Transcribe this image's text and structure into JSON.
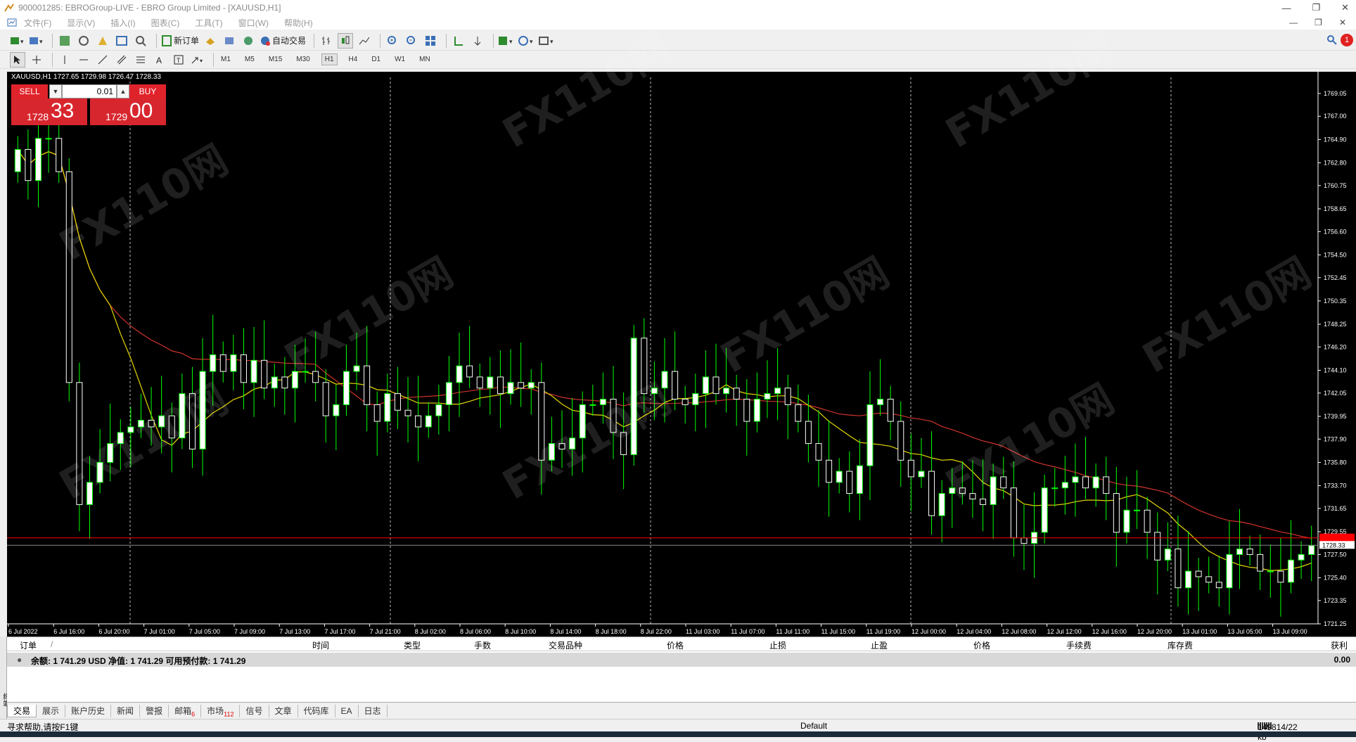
{
  "window": {
    "title": "900001285: EBROGroup-LIVE - EBRO Group Limited - [XAUUSD,H1]",
    "controls": [
      "—",
      "❐",
      "✕"
    ],
    "mdi_controls": [
      "—",
      "❐",
      "✕"
    ]
  },
  "menu": [
    "文件(F)",
    "显示(V)",
    "插入(I)",
    "图表(C)",
    "工具(T)",
    "窗口(W)",
    "帮助(H)"
  ],
  "toolbar": {
    "new_order": "新订单",
    "auto_trading": "自动交易",
    "timeframes": [
      "M1",
      "M5",
      "M15",
      "M30",
      "H1",
      "H4",
      "D1",
      "W1",
      "MN"
    ],
    "active_timeframe": "H1",
    "notification_count": "1"
  },
  "chart": {
    "header": "XAUUSD,H1  1727.65 1729.98 1726.47 1728.33",
    "trade_panel": {
      "sell_label": "SELL",
      "buy_label": "BUY",
      "lot": "0.01",
      "sell_small": "1728",
      "sell_big": "33",
      "buy_small": "1729",
      "buy_big": "00"
    },
    "bid_label": "1728.33",
    "ask_label": "1729.00",
    "watermark": "FX110网",
    "colors": {
      "background": "#000000",
      "bull_body": "#ffffff",
      "wick": "#00ff00",
      "ma_fast": "#e6d800",
      "ma_slow": "#d0332b",
      "ask_line": "#ff0000",
      "bid_line": "#888888"
    }
  },
  "chart_data": {
    "type": "candlestick",
    "symbol": "XAUUSD",
    "timeframe": "H1",
    "ylim": [
      1721.25,
      1770.5
    ],
    "y_ticks": [
      "1769.05",
      "1767.00",
      "1764.90",
      "1762.80",
      "1760.75",
      "1758.65",
      "1756.60",
      "1754.50",
      "1752.45",
      "1750.35",
      "1748.25",
      "1746.20",
      "1744.10",
      "1742.05",
      "1739.95",
      "1737.90",
      "1735.80",
      "1733.70",
      "1731.65",
      "1729.55",
      "1727.50",
      "1725.40",
      "1723.35",
      "1721.25"
    ],
    "x_ticks": [
      "6 Jul 2022",
      "6 Jul 16:00",
      "6 Jul 20:00",
      "7 Jul 01:00",
      "7 Jul 05:00",
      "7 Jul 09:00",
      "7 Jul 13:00",
      "7 Jul 17:00",
      "7 Jul 21:00",
      "8 Jul 02:00",
      "8 Jul 06:00",
      "8 Jul 10:00",
      "8 Jul 14:00",
      "8 Jul 18:00",
      "8 Jul 22:00",
      "11 Jul 03:00",
      "11 Jul 07:00",
      "11 Jul 11:00",
      "11 Jul 15:00",
      "11 Jul 19:00",
      "12 Jul 00:00",
      "12 Jul 04:00",
      "12 Jul 08:00",
      "12 Jul 12:00",
      "12 Jul 16:00",
      "12 Jul 20:00",
      "13 Jul 01:00",
      "13 Jul 05:00",
      "13 Jul 09:00"
    ],
    "closes": [
      1764.0,
      1761.2,
      1765.0,
      1765.0,
      1762.0,
      1743.0,
      1732.0,
      1734.0,
      1735.8,
      1737.5,
      1738.5,
      1739.0,
      1739.6,
      1739.0,
      1740.0,
      1738.0,
      1742.0,
      1737.0,
      1744.0,
      1745.5,
      1744.0,
      1745.5,
      1743.0,
      1745.0,
      1742.5,
      1743.5,
      1742.5,
      1744.0,
      1744.0,
      1743.0,
      1740.0,
      1741.0,
      1744.0,
      1744.5,
      1741.0,
      1739.5,
      1742.0,
      1740.5,
      1740.0,
      1739.0,
      1740.0,
      1741.0,
      1743.0,
      1744.5,
      1743.5,
      1742.5,
      1743.5,
      1742.0,
      1743.0,
      1742.5,
      1743.0,
      1736.0,
      1737.5,
      1737.0,
      1738.0,
      1741.0,
      1741.0,
      1741.5,
      1738.5,
      1736.5,
      1747.0,
      1742.0,
      1742.5,
      1744.0,
      1741.5,
      1741.0,
      1742.0,
      1743.5,
      1742.0,
      1742.5,
      1741.5,
      1739.5,
      1741.5,
      1742.0,
      1742.5,
      1741.0,
      1739.5,
      1737.5,
      1736.0,
      1734.0,
      1735.0,
      1733.0,
      1735.5,
      1741.0,
      1741.5,
      1739.5,
      1736.0,
      1734.5,
      1735.0,
      1731.0,
      1733.0,
      1733.5,
      1733.0,
      1732.5,
      1732.0,
      1734.5,
      1733.5,
      1729.0,
      1728.5,
      1729.5,
      1733.5,
      1733.5,
      1734.0,
      1734.5,
      1733.5,
      1734.5,
      1733.0,
      1729.5,
      1731.5,
      1731.5,
      1729.5,
      1727.0,
      1728.0,
      1724.5,
      1726.0,
      1725.5,
      1725.0,
      1724.5,
      1727.5,
      1728.0,
      1727.5,
      1726.0,
      1726.0,
      1725.0,
      1727.0,
      1727.5,
      1728.3
    ],
    "opens": [
      1762.0,
      1764.0,
      1761.2,
      1765.0,
      1765.0,
      1762.0,
      1743.0,
      1732.0,
      1734.0,
      1735.8,
      1737.5,
      1738.5,
      1739.0,
      1739.6,
      1739.0,
      1740.0,
      1738.0,
      1742.0,
      1737.0,
      1744.0,
      1745.5,
      1744.0,
      1745.5,
      1743.0,
      1745.0,
      1742.5,
      1743.5,
      1742.5,
      1744.0,
      1744.0,
      1743.0,
      1740.0,
      1741.0,
      1744.0,
      1744.5,
      1741.0,
      1739.5,
      1742.0,
      1740.5,
      1740.0,
      1739.0,
      1740.0,
      1741.0,
      1743.0,
      1744.5,
      1743.5,
      1742.5,
      1743.5,
      1742.0,
      1743.0,
      1742.5,
      1743.0,
      1736.0,
      1737.5,
      1737.0,
      1738.0,
      1741.0,
      1741.0,
      1741.5,
      1738.5,
      1736.5,
      1747.0,
      1742.0,
      1742.5,
      1744.0,
      1741.5,
      1741.0,
      1742.0,
      1743.5,
      1742.0,
      1742.5,
      1741.5,
      1739.5,
      1741.5,
      1742.0,
      1742.5,
      1741.0,
      1739.5,
      1737.5,
      1736.0,
      1734.0,
      1735.0,
      1733.0,
      1735.5,
      1741.0,
      1741.5,
      1739.5,
      1736.0,
      1734.5,
      1735.0,
      1731.0,
      1733.0,
      1733.5,
      1733.0,
      1732.5,
      1732.0,
      1734.5,
      1733.5,
      1729.0,
      1728.5,
      1729.5,
      1733.5,
      1733.5,
      1734.0,
      1734.5,
      1733.5,
      1734.5,
      1733.0,
      1729.5,
      1731.5,
      1731.5,
      1729.5,
      1727.0,
      1728.0,
      1724.5,
      1726.0,
      1725.5,
      1725.0,
      1724.5,
      1727.5,
      1728.0,
      1727.5,
      1726.0,
      1726.0,
      1725.0,
      1727.0,
      1727.5
    ]
  },
  "terminal": {
    "columns": [
      "订单",
      "时间",
      "类型",
      "手数",
      "交易品种",
      "价格",
      "止损",
      "止盈",
      "价格",
      "手续费",
      "库存费",
      "获利"
    ],
    "balance_text": "余额: 1 741.29 USD  净值: 1 741.29  可用预付款: 1 741.29",
    "profit": "0.00",
    "tabs": [
      {
        "label": "交易",
        "badge": ""
      },
      {
        "label": "展示",
        "badge": ""
      },
      {
        "label": "账户历史",
        "badge": ""
      },
      {
        "label": "新闻",
        "badge": ""
      },
      {
        "label": "警报",
        "badge": ""
      },
      {
        "label": "邮箱",
        "badge": "6"
      },
      {
        "label": "市场",
        "badge": "112"
      },
      {
        "label": "信号",
        "badge": ""
      },
      {
        "label": "文章",
        "badge": ""
      },
      {
        "label": "代码库",
        "badge": ""
      },
      {
        "label": "EA",
        "badge": ""
      },
      {
        "label": "日志",
        "badge": ""
      }
    ],
    "side_label": "终端"
  },
  "status": {
    "help": "寻求帮助,请按F1键",
    "profile": "Default",
    "traffic": "149814/22 kb"
  }
}
